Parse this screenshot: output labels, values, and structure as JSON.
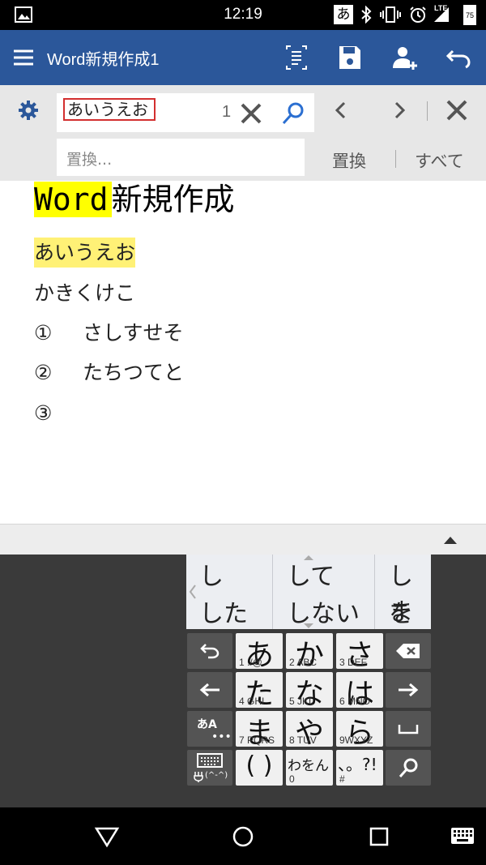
{
  "status_bar": {
    "time": "12:19",
    "battery_level": "75",
    "ime_indicator": "あ",
    "network_type": "LTE"
  },
  "app_bar": {
    "title": "Word新規作成1"
  },
  "find_bar": {
    "search_value": "あいうえお",
    "match_count": "1",
    "replace_placeholder": "置換...",
    "replace_button": "置換",
    "replace_all_button": "すべて"
  },
  "document": {
    "heading_highlight": "Word",
    "heading_rest": "新規作成",
    "lines": [
      {
        "text": "あいうえお"
      },
      {
        "text": "かきくけこ"
      },
      {
        "marker": "①",
        "text": "さしすせそ"
      },
      {
        "marker": "②",
        "text": "たちつてと"
      },
      {
        "marker": "③",
        "text": ""
      }
    ]
  },
  "keyboard": {
    "candidates": [
      "し",
      "した",
      "して",
      "しない",
      "しま",
      "を"
    ],
    "keys": [
      {
        "big": "あ",
        "small": "1  ./@"
      },
      {
        "big": "か",
        "small": "2  ABC"
      },
      {
        "big": "さ",
        "small": "3  DEF"
      },
      {
        "big": "た",
        "small": "4  GHI"
      },
      {
        "big": "な",
        "small": "5  JKL"
      },
      {
        "big": "は",
        "small": "6  MNO"
      },
      {
        "big": "ま",
        "small": "7 PQRS"
      },
      {
        "big": "や",
        "small": "8  TUV"
      },
      {
        "big": "ら",
        "small": "9WXYZ"
      },
      {
        "big": "( )",
        "small": ""
      },
      {
        "big": "わをん",
        "small": "0"
      },
      {
        "big": "、。?!",
        "small": "#"
      }
    ],
    "mode_key": "あA",
    "emoticon_key": "(^-^)"
  },
  "colors": {
    "app_bar": "#2b579a",
    "heading_highlight": "#ffff00",
    "match_highlight": "#fff176",
    "search_border": "#d32f2f"
  }
}
